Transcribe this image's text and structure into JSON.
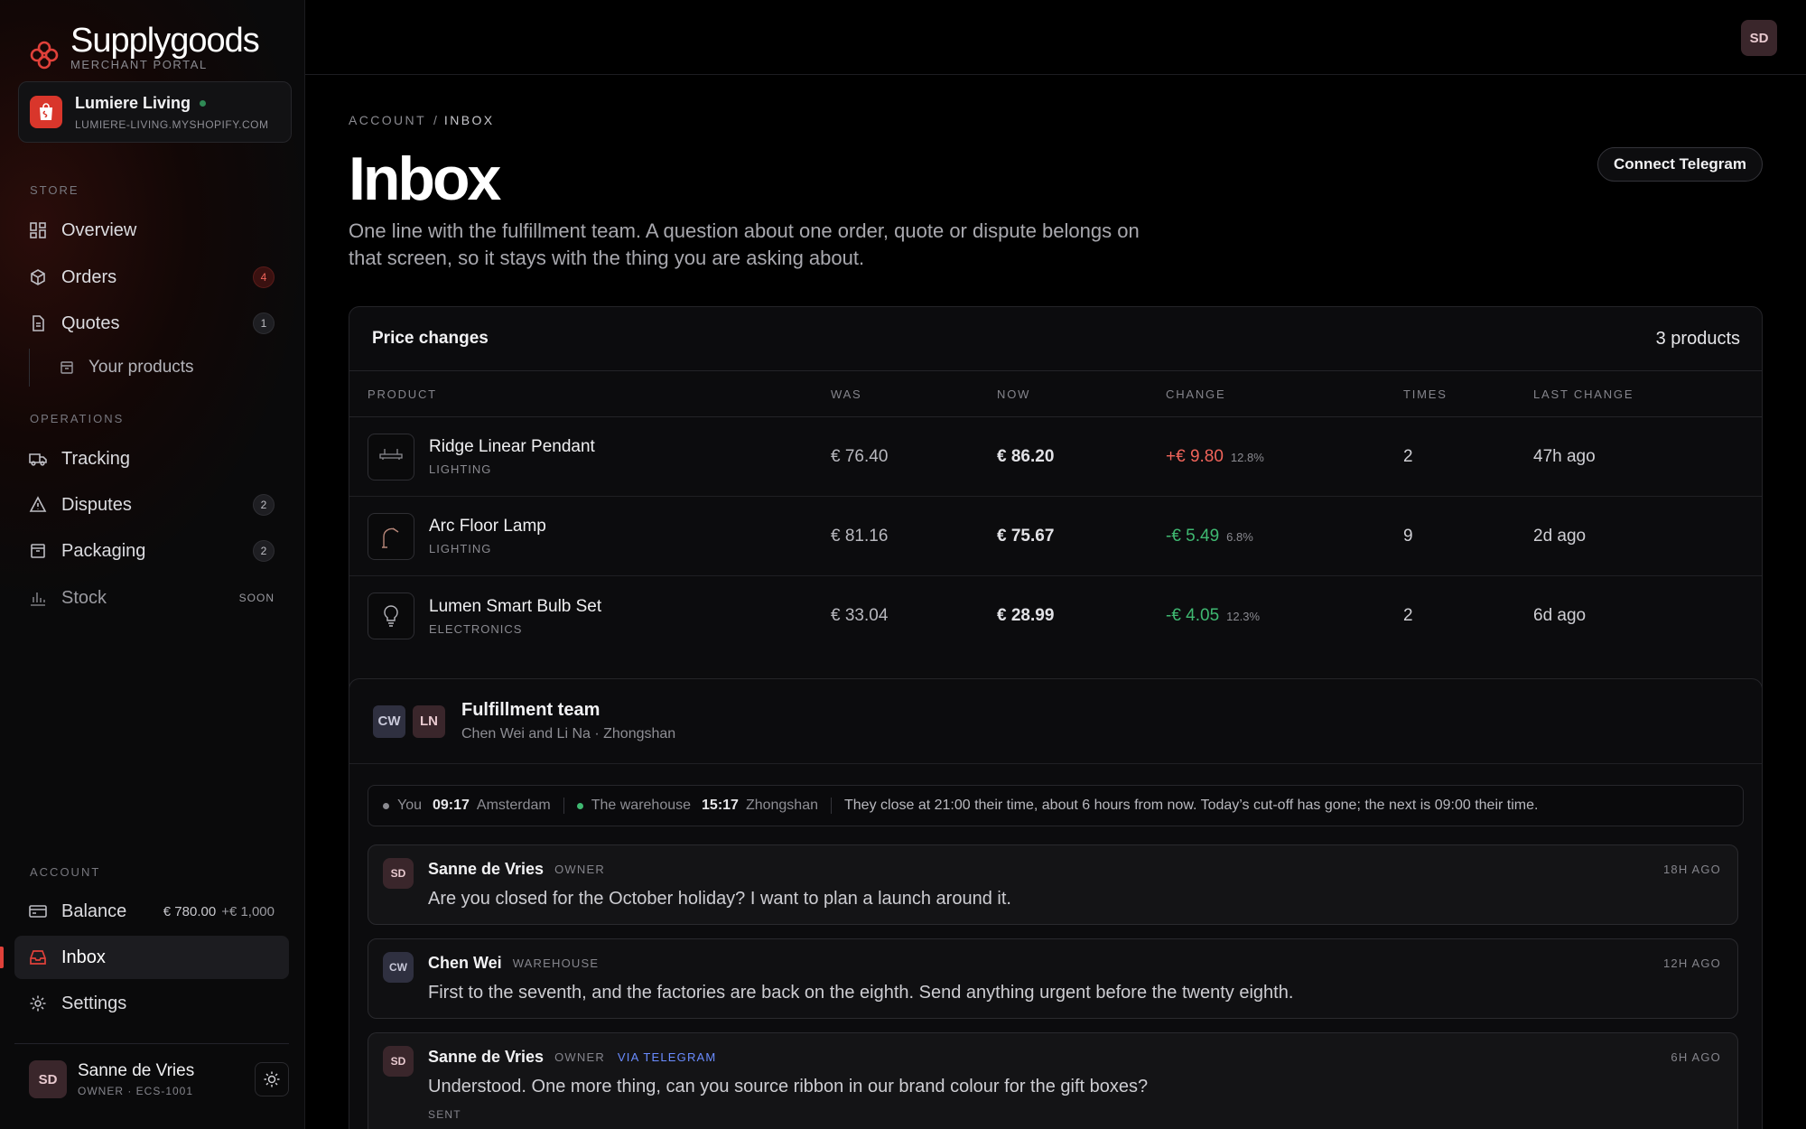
{
  "brand": {
    "name": "Supplygoods",
    "subtitle": "MERCHANT PORTAL",
    "accent": "#e0413a"
  },
  "store": {
    "name": "Lumiere Living",
    "url": "LUMIERE-LIVING.MYSHOPIFY.COM",
    "status_color": "#2f8a55"
  },
  "sidebar": {
    "sections": {
      "store": "STORE",
      "operations": "OPERATIONS",
      "account": "ACCOUNT"
    },
    "store_items": [
      {
        "label": "Overview",
        "icon": "grid-icon"
      },
      {
        "label": "Orders",
        "icon": "box-icon",
        "badge": "4"
      },
      {
        "label": "Quotes",
        "icon": "document-icon",
        "badge": "1"
      }
    ],
    "sub_item": {
      "label": "Your products",
      "icon": "archive-icon"
    },
    "operations_items": [
      {
        "label": "Tracking",
        "icon": "truck-icon"
      },
      {
        "label": "Disputes",
        "icon": "warning-icon",
        "badge": "2"
      },
      {
        "label": "Packaging",
        "icon": "package-icon",
        "badge": "2"
      },
      {
        "label": "Stock",
        "icon": "bar-chart-icon",
        "tag": "SOON"
      }
    ],
    "account_items": [
      {
        "label": "Balance",
        "icon": "credit-card-icon",
        "value": "€ 780.00",
        "pending": "+€ 1,000"
      },
      {
        "label": "Inbox",
        "icon": "inbox-icon",
        "active": true
      },
      {
        "label": "Settings",
        "icon": "gear-icon"
      }
    ],
    "user": {
      "initials": "SD",
      "name": "Sanne de Vries",
      "role": "OWNER · ECS-1001"
    }
  },
  "topbar": {
    "avatar_initials": "SD"
  },
  "page": {
    "breadcrumb": [
      "ACCOUNT",
      "INBOX"
    ],
    "title": "Inbox",
    "description": "One line with the fulfillment team. A question about one order, quote or dispute belongs on that screen, so it stays with the thing you are asking about.",
    "connect_button": "Connect Telegram"
  },
  "price_changes": {
    "title": "Price changes",
    "count": "3 products",
    "columns": [
      "PRODUCT",
      "WAS",
      "NOW",
      "CHANGE",
      "TIMES",
      "LAST CHANGE"
    ],
    "rows": [
      {
        "name": "Ridge Linear Pendant",
        "category": "LIGHTING",
        "icon": "pendant-lamp-icon",
        "was": "€ 76.40",
        "now": "€ 86.20",
        "change": "+€ 9.80",
        "direction": "up",
        "pct": "12.8%",
        "times": "2",
        "last": "47h ago"
      },
      {
        "name": "Arc Floor Lamp",
        "category": "LIGHTING",
        "icon": "floor-lamp-icon",
        "was": "€ 81.16",
        "now": "€ 75.67",
        "change": "-€ 5.49",
        "direction": "down",
        "pct": "6.8%",
        "times": "9",
        "last": "2d ago"
      },
      {
        "name": "Lumen Smart Bulb Set",
        "category": "ELECTRONICS",
        "icon": "bulb-icon",
        "was": "€ 33.04",
        "now": "€ 28.99",
        "change": "-€ 4.05",
        "direction": "down",
        "pct": "12.3%",
        "times": "2",
        "last": "6d ago"
      }
    ]
  },
  "thread": {
    "title": "Fulfillment team",
    "subtitle": "Chen Wei and Li Na · Zhongshan",
    "avatars": [
      "CW",
      "LN"
    ],
    "timezone": {
      "you_label": "You",
      "you_time": "09:17",
      "you_city": "Amsterdam",
      "wh_label": "The warehouse",
      "wh_time": "15:17",
      "wh_city": "Zhongshan",
      "note": "They close at 21:00 their time, about 6 hours from now. Today’s cut-off has gone; the next is 09:00 their time."
    },
    "messages": [
      {
        "initials": "SD",
        "author": "Sanne de Vries",
        "role": "OWNER",
        "via": "",
        "time": "18H AGO",
        "text": "Are you closed for the October holiday? I want to plan a launch around it.",
        "status": ""
      },
      {
        "initials": "CW",
        "author": "Chen Wei",
        "role": "WAREHOUSE",
        "via": "",
        "time": "12H AGO",
        "text": "First to the seventh, and the factories are back on the eighth. Send anything urgent before the twenty eighth.",
        "status": ""
      },
      {
        "initials": "SD",
        "author": "Sanne de Vries",
        "role": "OWNER",
        "via": "VIA TELEGRAM",
        "time": "6H AGO",
        "text": "Understood. One more thing, can you source ribbon in our brand colour for the gift boxes?",
        "status": "SENT"
      }
    ]
  }
}
